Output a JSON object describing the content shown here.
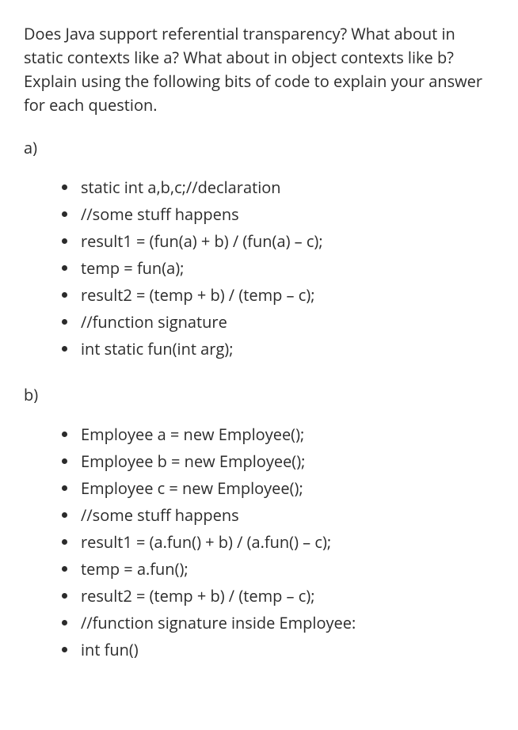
{
  "question": "Does Java support referential transparency? What about in static contexts like a? What about in object contexts like b? Explain using the following bits of code to explain your answer for each question.",
  "sections": {
    "a": {
      "label": "a)",
      "items": [
        "static int a,b,c;//declaration",
        "//some stuff happens",
        "result1 = (fun(a) + b) / (fun(a) – c);",
        "temp = fun(a);",
        "result2 = (temp + b) / (temp – c);",
        "//function signature",
        "int static fun(int arg);"
      ]
    },
    "b": {
      "label": "b)",
      "items": [
        "Employee a = new Employee();",
        "Employee b = new Employee();",
        "Employee c = new Employee();",
        "//some stuff happens",
        "result1 = (a.fun() + b) / (a.fun() – c);",
        "temp = a.fun();",
        "result2 = (temp + b) / (temp – c);",
        "//function signature inside Employee:",
        "int fun()"
      ]
    }
  }
}
